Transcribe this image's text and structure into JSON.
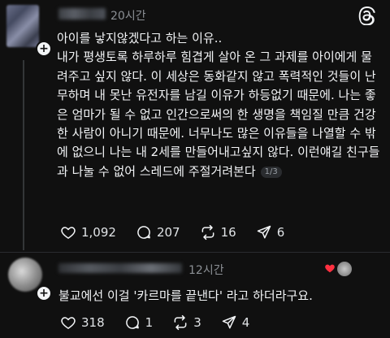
{
  "post": {
    "timestamp": "20시간",
    "body": "아이를 낳지않겠다고 하는 이유..\n내가 평생토록 하루하루 힘겹게 살아 온 그 과제를 아이에게 물려주고 싶지 않다. 이 세상은 동화같지 않고 폭력적인 것들이 난무하며 내 못난 유전자를 남길 이유가 하등없기 때문에. 나는 좋은 엄마가 될 수 없고 인간으로써의 한 생명을 책임질 만큼 건강한 사람이 아니기 때문에. 너무나도 많은 이유들을 나열할 수 밖에 없으니 나는 내 2세를 만들어내고싶지 않다. 이런얘길 친구들과 나눌 수 없어 스레드에 주절거려본다",
    "page_badge": "1/3",
    "likes": "1,092",
    "comments": "207",
    "reposts": "16",
    "shares": "6"
  },
  "reply": {
    "timestamp": "12시간",
    "body": "불교에선 이걸 '카르마를 끝낸다' 라고 하더라구요.",
    "likes": "318",
    "comments": "1",
    "reposts": "3",
    "shares": "4"
  },
  "icons": {
    "heart": "heart-icon",
    "comment": "comment-icon",
    "repost": "repost-icon",
    "share": "share-icon",
    "logo": "threads-logo-icon"
  },
  "colors": {
    "liked_heart": "#ff3040",
    "muted_text": "#8b8f94"
  }
}
